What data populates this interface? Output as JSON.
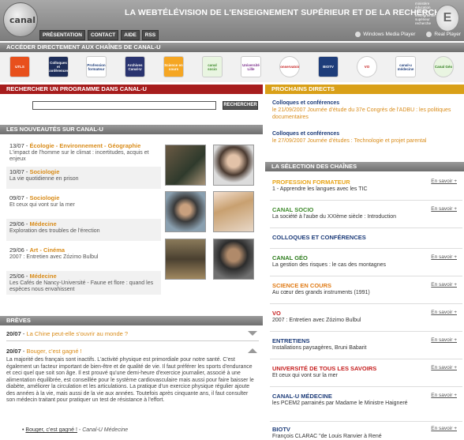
{
  "header": {
    "logo_text": "canal",
    "title": "LA WEBTÉLÉVISION DE L'ENSEIGNEMENT SUPÉRIEUR ET DE LA RECHERCHE",
    "nav": [
      "PRÉSENTATION",
      "CONTACT",
      "AIDE",
      "RSS"
    ],
    "ministry": "ministère éducation nationale enseignement supérieur recherche",
    "players": [
      "Windows Media Player",
      "Real Player"
    ]
  },
  "channels": {
    "title": "ACCÉDER DIRECTEMENT AUX CHAÎNES DE CANAL-U",
    "items": [
      "UTLS",
      "Colloques et conférences",
      "Profession formateur",
      "Archives Canal-U",
      "Science en cours",
      "canal socio",
      "Université Lille",
      "Conservatoire",
      "BIOTV",
      "VO",
      "canal-u médecine",
      "Canal Géo"
    ]
  },
  "search": {
    "title": "RECHERCHER UN PROGRAMME DANS CANAL-U",
    "placeholder": "",
    "button": "RECHERCHER"
  },
  "nouveautes": {
    "title": "LES NOUVEAUTÉS SUR CANAL-U",
    "items": [
      {
        "date": "13/07",
        "cat": "Écologie - Environnement - Géographie",
        "desc": "L'impact de l'homme sur le climat : incertitudes, acquis et enjeux"
      },
      {
        "date": "10/07",
        "cat": "Sociologie",
        "desc": "La vie quotidienne en prison"
      },
      {
        "date": "09/07",
        "cat": "Sociologie",
        "desc": "Et ceux qui vont sur la mer"
      },
      {
        "date": "29/06",
        "cat": "Médecine",
        "desc": "Exploration des troubles de l'érection"
      },
      {
        "date": "29/06",
        "cat": "Art - Cinéma",
        "desc": "2007 : Entretien avec Zózimo Bulbul"
      },
      {
        "date": "25/06",
        "cat": "Médecine",
        "desc": "Les Cafés de Nancy-Université - Faune et flore : quand les espèces nous envahissent"
      }
    ]
  },
  "breves": {
    "title": "BRÈVES",
    "item1": {
      "date": "20/07",
      "title": "La Chine peut-elle s'ouvrir au monde ?"
    },
    "item2": {
      "date": "20/07",
      "title": "Bouger, c'est gagné !"
    },
    "text": "La majorité des français sont inactifs. L'activité physique est primordiale pour notre santé. C'est également un facteur important de bien-être et de qualité de vie. Il faut préférer les sports d'endurance et ceci quel que soit son âge. Il est prouvé qu'une demi-heure d'exercice journalier, associé à une alimentation équilibrée, est conseillée pour le système cardiovasculaire mais aussi pour faire baisser le diabète, améliorer la circulation et les articulations. La pratique d'un exercice physique régulier ajoute des années à la vie, mais aussi de la vie aux années. Toutefois après cinquante ans, il faut consulter son médecin traitant pour pratiquer un test de résistance à l'effort.",
    "link": "Bouger, c'est gagné !",
    "link_suffix": " - Canal-U Médecine"
  },
  "directs": {
    "title": "PROCHAINS DIRECTS",
    "items": [
      {
        "title": "Colloques et conférences",
        "desc": "le 21/09/2007 Journée d'étude du 37e Congrès de l'ADBU : les politiques documentaires"
      },
      {
        "title": "Colloques et conférences",
        "desc": "le 27/09/2007 Journée d'études : Technologie et projet parental"
      }
    ]
  },
  "selection": {
    "title": "LA SÉLECTION DES CHAÎNES",
    "more": "En savoir +",
    "items": [
      {
        "name": "PROFESSION FORMATEUR",
        "color": "#e8a417",
        "sub": "1 - Apprendre les langues avec les TIC"
      },
      {
        "name": "CANAL SOCIO",
        "color": "#3f8a2c",
        "sub": "La société à l'aube du XXIème siècle : Introduction"
      },
      {
        "name": "COLLOQUES ET CONFÉRENCES",
        "color": "#1e3d7a",
        "sub": ""
      },
      {
        "name": "CANAL GÉO",
        "color": "#2e7d1d",
        "sub": "La gestion des risques : le cas des montagnes"
      },
      {
        "name": "SCIENCE EN COURS",
        "color": "#e07b16",
        "sub": "Au cœur des grands instruments (1991)"
      },
      {
        "name": "VO",
        "color": "#c62020",
        "sub": "2007 : Entretien avec Zózimo Bulbul"
      },
      {
        "name": "ENTRETIENS",
        "color": "#1e3d7a",
        "sub": "Installations paysagères, Bruni Babarit"
      },
      {
        "name": "UNIVERSITÉ DE TOUS LES SAVOIRS",
        "color": "#c62020",
        "sub": "Et ceux qui vont sur la mer"
      },
      {
        "name": "CANAL-U MÉDECINE",
        "color": "#1e3d7a",
        "sub": "les PCEM2 parrainés par Madame le Ministre Haigneré"
      },
      {
        "name": "BIOTV",
        "color": "#1e3d7a",
        "sub": "François CLARAC \"de Louis Ranvier à René"
      }
    ]
  },
  "colors": {
    "accent_orange": "#d98c1a",
    "accent_red": "#a71d1d",
    "accent_gold": "#d9a018"
  }
}
